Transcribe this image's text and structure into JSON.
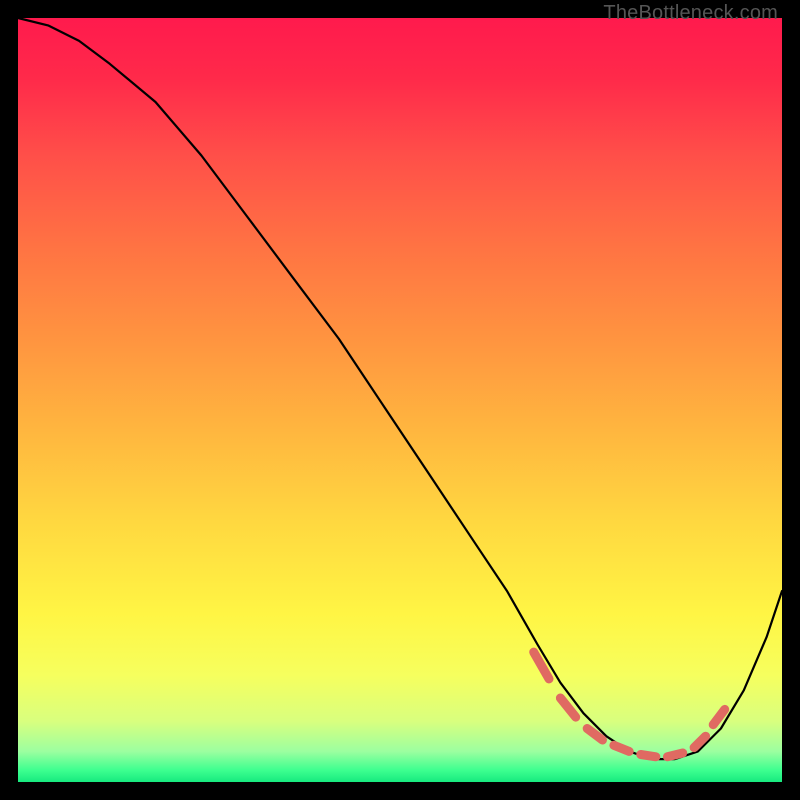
{
  "watermark": "TheBottleneck.com",
  "chart_data": {
    "type": "line",
    "title": "",
    "xlabel": "",
    "ylabel": "",
    "xlim": [
      0,
      100
    ],
    "ylim": [
      0,
      100
    ],
    "grid": false,
    "legend": false,
    "series": [
      {
        "name": "curve",
        "x": [
          0,
          4,
          8,
          12,
          18,
          24,
          30,
          36,
          42,
          48,
          54,
          60,
          64,
          68,
          71,
          74,
          77,
          80,
          83,
          86,
          89,
          92,
          95,
          98,
          100
        ],
        "y": [
          100,
          99,
          97,
          94,
          89,
          82,
          74,
          66,
          58,
          49,
          40,
          31,
          25,
          18,
          13,
          9,
          6,
          4,
          3,
          3,
          4,
          7,
          12,
          19,
          25
        ]
      }
    ],
    "highlight_dashes": [
      {
        "x1": 67.5,
        "y1": 17.0,
        "x2": 69.5,
        "y2": 13.5
      },
      {
        "x1": 71.0,
        "y1": 11.0,
        "x2": 73.0,
        "y2": 8.5
      },
      {
        "x1": 74.5,
        "y1": 7.0,
        "x2": 76.5,
        "y2": 5.5
      },
      {
        "x1": 78.0,
        "y1": 4.8,
        "x2": 80.0,
        "y2": 4.0
      },
      {
        "x1": 81.5,
        "y1": 3.6,
        "x2": 83.5,
        "y2": 3.3
      },
      {
        "x1": 85.0,
        "y1": 3.3,
        "x2": 87.0,
        "y2": 3.8
      },
      {
        "x1": 88.5,
        "y1": 4.5,
        "x2": 90.0,
        "y2": 6.0
      },
      {
        "x1": 91.0,
        "y1": 7.5,
        "x2": 92.5,
        "y2": 9.5
      }
    ]
  }
}
